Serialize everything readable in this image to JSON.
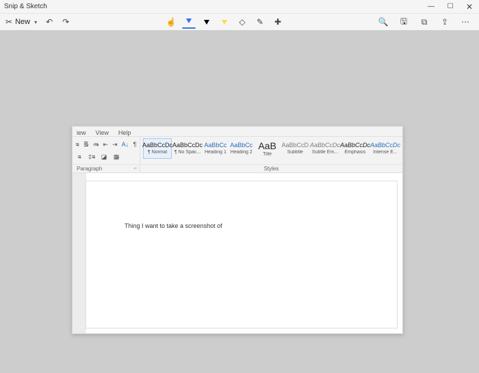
{
  "window": {
    "title": "Snip & Sketch"
  },
  "toolbar": {
    "new_label": "New"
  },
  "word": {
    "tabs": {
      "iew": "iew",
      "view": "View",
      "help": "Help"
    },
    "styles": [
      {
        "sample": "AaBbCcDc",
        "label": "¶ Normal"
      },
      {
        "sample": "AaBbCcDc",
        "label": "¶ No Spac..."
      },
      {
        "sample": "AaBbCc",
        "label": "Heading 1"
      },
      {
        "sample": "AaBbCc",
        "label": "Heading 2"
      },
      {
        "sample": "AaB",
        "label": "Title"
      },
      {
        "sample": "AaBbCcD",
        "label": "Subtitle"
      },
      {
        "sample": "AaBbCcDc",
        "label": "Subtle Em..."
      },
      {
        "sample": "AaBbCcDc",
        "label": "Emphasis"
      },
      {
        "sample": "AaBbCcDc",
        "label": "Intense E..."
      }
    ],
    "group_paragraph": "Paragraph",
    "group_styles": "Styles",
    "launcher": "⌐",
    "doc_text": "Thing I want to take a screenshot of"
  }
}
